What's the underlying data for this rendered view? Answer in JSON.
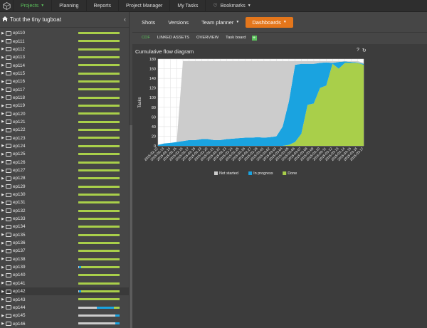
{
  "nav": {
    "items": [
      {
        "label": "Projects",
        "active": true,
        "caret": true
      },
      {
        "label": "Planning",
        "active": false,
        "caret": false
      },
      {
        "label": "Reports",
        "active": false,
        "caret": false
      },
      {
        "label": "Project Manager",
        "active": false,
        "caret": false
      },
      {
        "label": "My Tasks",
        "active": false,
        "caret": false
      },
      {
        "label": "Bookmarks",
        "active": false,
        "caret": true
      }
    ]
  },
  "sidebar": {
    "project_name": "Toot the tiny tugboat",
    "collapse_glyph": "‹",
    "rows": [
      {
        "label": "ep110",
        "bar": [
          [
            0,
            0
          ],
          [
            0,
            0
          ],
          [
            1,
            "#a9cf4a"
          ]
        ]
      },
      {
        "label": "ep111",
        "bar": [
          [
            0,
            0
          ],
          [
            0,
            0
          ],
          [
            1,
            "#a9cf4a"
          ]
        ]
      },
      {
        "label": "ep112",
        "bar": [
          [
            0,
            0
          ],
          [
            0,
            0
          ],
          [
            1,
            "#a9cf4a"
          ]
        ]
      },
      {
        "label": "ep113",
        "bar": [
          [
            0,
            0
          ],
          [
            0,
            0
          ],
          [
            1,
            "#a9cf4a"
          ]
        ]
      },
      {
        "label": "ep114",
        "bar": [
          [
            0,
            0
          ],
          [
            0,
            0
          ],
          [
            1,
            "#a9cf4a"
          ]
        ]
      },
      {
        "label": "ep115",
        "bar": [
          [
            0,
            0
          ],
          [
            0,
            0
          ],
          [
            1,
            "#a9cf4a"
          ]
        ]
      },
      {
        "label": "ep116",
        "bar": [
          [
            0,
            0
          ],
          [
            0,
            0
          ],
          [
            1,
            "#a9cf4a"
          ]
        ]
      },
      {
        "label": "ep117",
        "bar": [
          [
            0,
            0
          ],
          [
            0,
            0
          ],
          [
            1,
            "#a9cf4a"
          ]
        ]
      },
      {
        "label": "ep118",
        "bar": [
          [
            0,
            0
          ],
          [
            0,
            0
          ],
          [
            1,
            "#a9cf4a"
          ]
        ]
      },
      {
        "label": "ep119",
        "bar": [
          [
            0,
            0
          ],
          [
            0,
            0
          ],
          [
            1,
            "#a9cf4a"
          ]
        ]
      },
      {
        "label": "ep120",
        "bar": [
          [
            0,
            0
          ],
          [
            0,
            0
          ],
          [
            1,
            "#a9cf4a"
          ]
        ]
      },
      {
        "label": "ep121",
        "bar": [
          [
            0,
            0
          ],
          [
            0,
            0
          ],
          [
            1,
            "#a9cf4a"
          ]
        ]
      },
      {
        "label": "ep122",
        "bar": [
          [
            0,
            0
          ],
          [
            0,
            0
          ],
          [
            1,
            "#a9cf4a"
          ]
        ]
      },
      {
        "label": "ep123",
        "bar": [
          [
            0,
            0
          ],
          [
            0,
            0
          ],
          [
            1,
            "#a9cf4a"
          ]
        ]
      },
      {
        "label": "ep124",
        "bar": [
          [
            0,
            0
          ],
          [
            0,
            0
          ],
          [
            1,
            "#a9cf4a"
          ]
        ]
      },
      {
        "label": "ep125",
        "bar": [
          [
            0,
            0
          ],
          [
            0,
            0
          ],
          [
            1,
            "#a9cf4a"
          ]
        ]
      },
      {
        "label": "ep126",
        "bar": [
          [
            0,
            0
          ],
          [
            0,
            0
          ],
          [
            1,
            "#a9cf4a"
          ]
        ]
      },
      {
        "label": "ep127",
        "bar": [
          [
            0,
            0
          ],
          [
            0,
            0
          ],
          [
            1,
            "#a9cf4a"
          ]
        ]
      },
      {
        "label": "ep128",
        "bar": [
          [
            0,
            0
          ],
          [
            0,
            0
          ],
          [
            1,
            "#a9cf4a"
          ]
        ]
      },
      {
        "label": "ep129",
        "bar": [
          [
            0,
            0
          ],
          [
            0,
            0
          ],
          [
            1,
            "#a9cf4a"
          ]
        ]
      },
      {
        "label": "ep130",
        "bar": [
          [
            0,
            0
          ],
          [
            0,
            0
          ],
          [
            1,
            "#a9cf4a"
          ]
        ]
      },
      {
        "label": "ep131",
        "bar": [
          [
            0,
            0
          ],
          [
            0,
            0
          ],
          [
            1,
            "#a9cf4a"
          ]
        ]
      },
      {
        "label": "ep132",
        "bar": [
          [
            0,
            0
          ],
          [
            0,
            0
          ],
          [
            1,
            "#a9cf4a"
          ]
        ]
      },
      {
        "label": "ep133",
        "bar": [
          [
            0,
            0
          ],
          [
            0,
            0
          ],
          [
            1,
            "#a9cf4a"
          ]
        ]
      },
      {
        "label": "ep134",
        "bar": [
          [
            0,
            0
          ],
          [
            0,
            0
          ],
          [
            1,
            "#a9cf4a"
          ]
        ]
      },
      {
        "label": "ep135",
        "bar": [
          [
            0,
            0
          ],
          [
            0,
            0
          ],
          [
            1,
            "#a9cf4a"
          ]
        ]
      },
      {
        "label": "ep136",
        "bar": [
          [
            0,
            0
          ],
          [
            0,
            0
          ],
          [
            1,
            "#a9cf4a"
          ]
        ]
      },
      {
        "label": "ep137",
        "bar": [
          [
            0,
            0
          ],
          [
            0,
            0
          ],
          [
            1,
            "#a9cf4a"
          ]
        ]
      },
      {
        "label": "ep138",
        "bar": [
          [
            0,
            0
          ],
          [
            0,
            0
          ],
          [
            1,
            "#a9cf4a"
          ]
        ]
      },
      {
        "label": "ep139",
        "bar": [
          [
            0.02,
            "#cccccc"
          ],
          [
            0.05,
            "#1aa3e0"
          ],
          [
            0.93,
            "#a9cf4a"
          ]
        ]
      },
      {
        "label": "ep140",
        "bar": [
          [
            0,
            0
          ],
          [
            0,
            0
          ],
          [
            1,
            "#a9cf4a"
          ]
        ]
      },
      {
        "label": "ep141",
        "bar": [
          [
            0,
            0
          ],
          [
            0,
            0
          ],
          [
            1,
            "#a9cf4a"
          ]
        ]
      },
      {
        "label": "ep142",
        "bar": [
          [
            0.02,
            "#cccccc"
          ],
          [
            0.05,
            "#1aa3e0"
          ],
          [
            0.93,
            "#a9cf4a"
          ]
        ],
        "selected": true
      },
      {
        "label": "ep143",
        "bar": [
          [
            0,
            0
          ],
          [
            0,
            0
          ],
          [
            1,
            "#a9cf4a"
          ]
        ]
      },
      {
        "label": "ep144",
        "bar": [
          [
            0.45,
            "#cccccc"
          ],
          [
            0.42,
            "#1aa3e0"
          ],
          [
            0.13,
            "#a9cf4a"
          ]
        ]
      },
      {
        "label": "ep145",
        "bar": [
          [
            0.9,
            "#cccccc"
          ],
          [
            0.1,
            "#1aa3e0"
          ],
          [
            0,
            0
          ]
        ]
      },
      {
        "label": "ep146",
        "bar": [
          [
            0.9,
            "#cccccc"
          ],
          [
            0.1,
            "#1aa3e0"
          ],
          [
            0,
            0
          ]
        ]
      }
    ]
  },
  "tabs": {
    "primary": [
      {
        "label": "Shots",
        "style": "plain"
      },
      {
        "label": "Versions",
        "style": "plain"
      },
      {
        "label": "Team planner",
        "style": "plain",
        "caret": true
      },
      {
        "label": "Dashboards",
        "style": "orange",
        "caret": true
      }
    ],
    "secondary": [
      {
        "label": "CDF",
        "active": true
      },
      {
        "label": "LINKED ASSETS",
        "active": false
      },
      {
        "label": "OVERVIEW",
        "active": false
      },
      {
        "label": "Task board",
        "active": false
      }
    ],
    "add_glyph": "+"
  },
  "panel": {
    "title": "Cumulative flow diagram",
    "icons": [
      "help-icon",
      "refresh-icon"
    ],
    "help_glyph": "?",
    "refresh_glyph": "↻"
  },
  "colors": {
    "not_started": "#cccccc",
    "in_progress": "#1aa3e0",
    "done": "#a9cf4a",
    "grid": "#dddddd",
    "plot_bg": "#ffffff"
  },
  "chart_data": {
    "type": "area",
    "title": "",
    "ylabel": "Tasks",
    "xlabel": "",
    "ylim": [
      0,
      180
    ],
    "yticks": [
      0,
      20,
      40,
      60,
      80,
      100,
      120,
      140,
      160,
      180
    ],
    "grid": true,
    "legend": "bottom",
    "stacked": true,
    "x": [
      "2015-02-12",
      "2015-02-13",
      "2015-02-14",
      "2015-02-15",
      "2015-02-16",
      "2015-02-17",
      "2015-02-18",
      "2015-02-19",
      "2015-02-20",
      "2015-02-21",
      "2015-02-22",
      "2015-02-23",
      "2015-02-24",
      "2015-02-25",
      "2015-02-26",
      "2015-02-27",
      "2015-02-28",
      "2015-03-01",
      "2015-03-02",
      "2015-03-03",
      "2015-03-04",
      "2015-03-05",
      "2015-03-06",
      "2015-03-07",
      "2015-03-08",
      "2015-03-09",
      "2015-03-10",
      "2015-03-11",
      "2015-03-12",
      "2015-03-13",
      "2015-03-14",
      "2015-03-15",
      "2015-03-16",
      "2015-03-17"
    ],
    "xticks": [
      "2015-02-12",
      "2015-02-13",
      "2015-02-14",
      "2015-02-15",
      "2015-02-16",
      "2015-02-17",
      "2015-02-18",
      "2015-02-19",
      "2015-02-20",
      "2015-02-21",
      "2015-02-22",
      "2015-02-23",
      "2015-02-24",
      "2015-02-25",
      "2015-02-26",
      "2015-02-27",
      "2015-02-28",
      "2015-03-01",
      "2015-03-02",
      "2015-03-03",
      "2015-03-04",
      "2015-03-05",
      "2015-03-06",
      "2015-03-07",
      "2015-03-08",
      "2015-03-09",
      "2015-03-10",
      "2015-03-11",
      "2015-03-12",
      "2015-03-13",
      "2015-03-14",
      "2015-03-15",
      "2015-03-16",
      "2015-03-17"
    ],
    "series": [
      {
        "name": "Done",
        "color": "#a9cf4a",
        "values": [
          0,
          0,
          0,
          0,
          0,
          0,
          0,
          0,
          0,
          0,
          0,
          0,
          0,
          0,
          0,
          0,
          0,
          0,
          0,
          0,
          0,
          2,
          8,
          25,
          85,
          88,
          120,
          125,
          170,
          160,
          172,
          172,
          172,
          168
        ]
      },
      {
        "name": "In progress",
        "color": "#1aa3e0",
        "values": [
          2,
          5,
          6,
          8,
          10,
          12,
          12,
          14,
          14,
          12,
          12,
          14,
          15,
          16,
          17,
          17,
          18,
          17,
          18,
          20,
          40,
          90,
          160,
          145,
          85,
          82,
          52,
          48,
          2,
          14,
          3,
          2,
          1,
          2
        ]
      },
      {
        "name": "Not started",
        "color": "#cccccc",
        "values": [
          0,
          0,
          0,
          0,
          166,
          164,
          164,
          162,
          162,
          164,
          164,
          162,
          161,
          160,
          159,
          159,
          158,
          159,
          158,
          156,
          136,
          84,
          8,
          6,
          6,
          6,
          4,
          3,
          4,
          2,
          1,
          2,
          3,
          2
        ]
      }
    ]
  }
}
